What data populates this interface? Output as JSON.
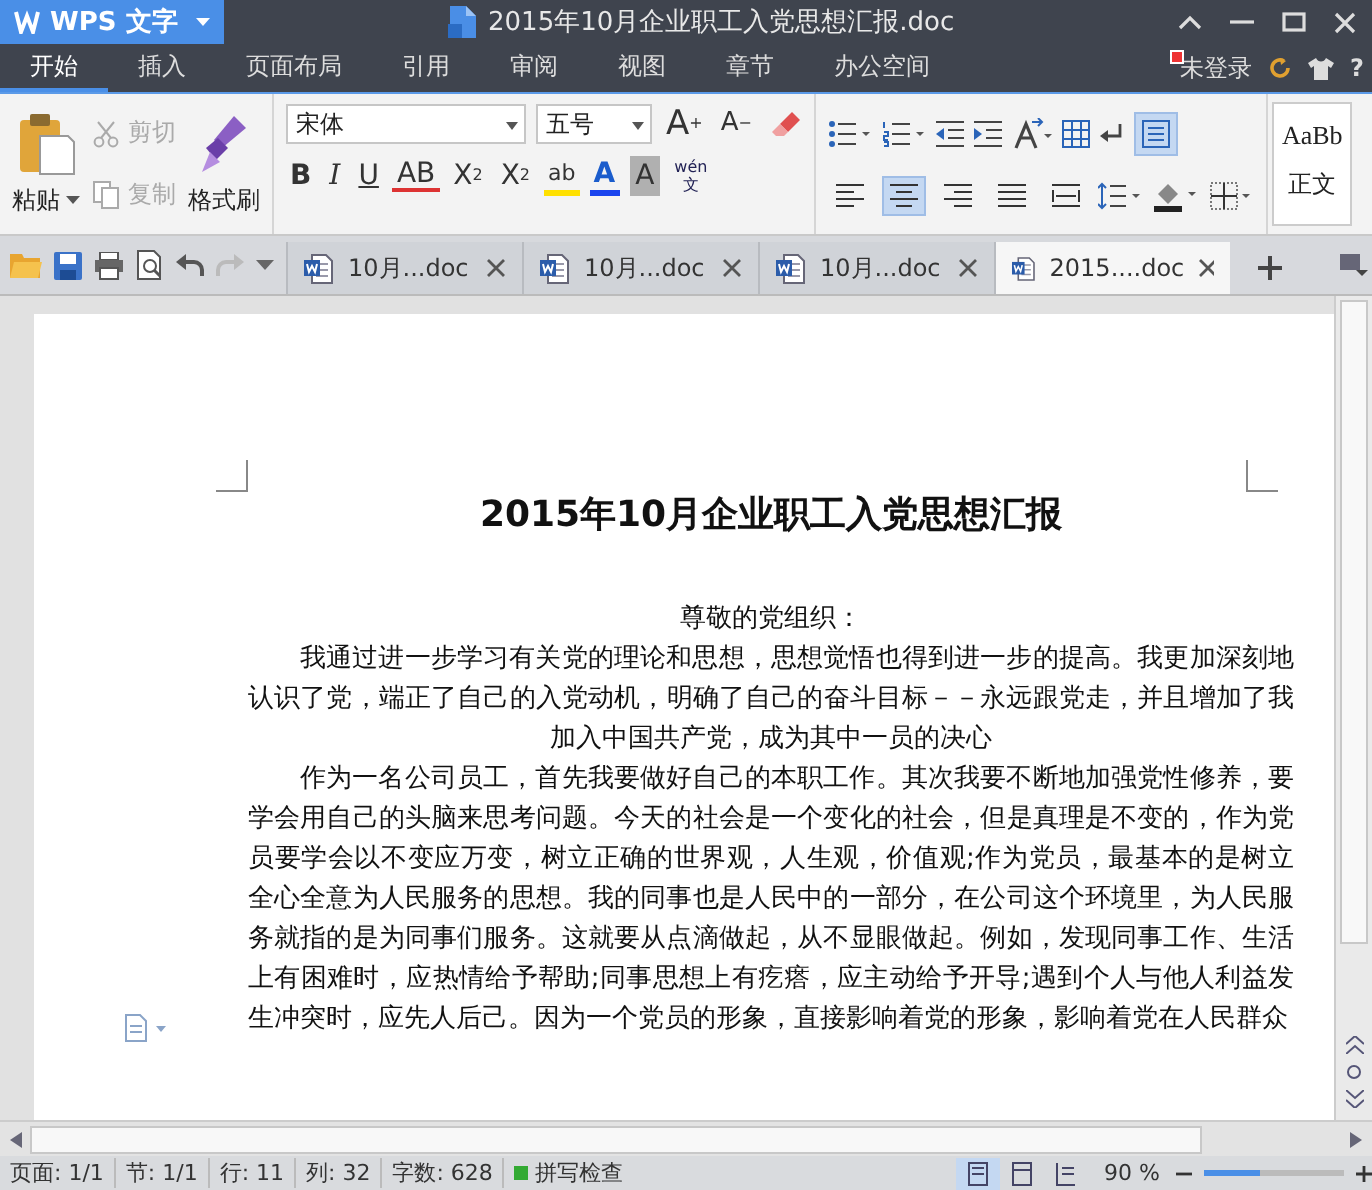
{
  "app_menu": {
    "label": "WPS 文字"
  },
  "window": {
    "title": "2015年10月企业职工入党思想汇报.doc"
  },
  "menu_tabs": [
    {
      "label": "开始",
      "selected": true
    },
    {
      "label": "插入",
      "selected": false
    },
    {
      "label": "页面布局",
      "selected": false
    },
    {
      "label": "引用",
      "selected": false
    },
    {
      "label": "审阅",
      "selected": false
    },
    {
      "label": "视图",
      "selected": false
    },
    {
      "label": "章节",
      "selected": false
    },
    {
      "label": "办公空间",
      "selected": false
    }
  ],
  "account": {
    "label": "未登录",
    "help": "?"
  },
  "ribbon": {
    "paste": "粘贴",
    "cut": {
      "label": "剪切",
      "disabled": true
    },
    "copy": {
      "label": "复制",
      "disabled": true
    },
    "format_painter": "格式刷",
    "font_name": "宋体",
    "font_size": "五号",
    "size_buttons": [
      {
        "kind": "grow",
        "label": "A",
        "sign": "+"
      },
      {
        "kind": "shrink",
        "label": "A",
        "sign": "−"
      }
    ],
    "font_buttons": [
      {
        "kind": "bold",
        "label": "B"
      },
      {
        "kind": "italic",
        "label": "I"
      },
      {
        "kind": "underline",
        "label": "U"
      },
      {
        "kind": "strike",
        "label": "AB"
      },
      {
        "kind": "sup",
        "label": "X",
        "sub": "2"
      },
      {
        "kind": "sub",
        "label": "X",
        "sub": "2"
      },
      {
        "kind": "highlight",
        "label": "ab"
      },
      {
        "kind": "color",
        "label": "A"
      },
      {
        "kind": "shade",
        "label": "A"
      },
      {
        "kind": "pinyin",
        "label": "wén",
        "sub": "文"
      }
    ],
    "alignment": [
      {
        "kind": "left",
        "selected": false
      },
      {
        "kind": "center",
        "selected": true
      },
      {
        "kind": "right",
        "selected": false
      },
      {
        "kind": "justify",
        "selected": false
      },
      {
        "kind": "distributed",
        "selected": false
      }
    ],
    "marks_on": true,
    "style_preview": "AaBb",
    "style_name": "正文"
  },
  "doc_tabs": [
    {
      "label": "10月...doc",
      "selected": false
    },
    {
      "label": "10月...doc",
      "selected": false
    },
    {
      "label": "10月...doc",
      "selected": false
    },
    {
      "label": "2015....doc",
      "selected": true
    }
  ],
  "document": {
    "title": "2015年10月企业职工入党思想汇报",
    "greeting": "尊敬的党组织：",
    "paragraphs": [
      {
        "kind": "centered",
        "text": "我通过进一步学习有关党的理论和思想，思想觉悟也得到进一步的提高。我更加深刻地认识了党，端正了自己的入党动机，明确了自己的奋斗目标－－永远跟党走，并且增加了我加入中国共产党，成为其中一员的决心"
      },
      {
        "kind": "justified",
        "text": "作为一名公司员工，首先我要做好自己的本职工作。其次我要不断地加强党性修养，要学会用自己的头脑来思考问题。今天的社会是一个变化的社会，但是真理是不变的，作为党员要学会以不变应万变，树立正确的世界观，人生观，价值观;作为党员，最基本的是树立全心全意为人民服务的思想。我的同事也是人民中的一部分，在公司这个环境里，为人民服务就指的是为同事们服务。这就要从点滴做起，从不显眼做起。例如，发现同事工作、生活上有困难时，应热情给予帮助;同事思想上有疙瘩，应主动给予开导;遇到个人与他人利益发生冲突时，应先人后己。因为一个党员的形象，直接影响着党的形象，影响着党在人民群众"
      }
    ]
  },
  "status_bar": {
    "items": [
      "页面: 1/1",
      "节: 1/1",
      "行: 11",
      "列: 32",
      "字数: 628"
    ],
    "spell_check": "拼写检查",
    "zoom": "90 %",
    "zoom_slider": {
      "level": 0.4
    }
  }
}
